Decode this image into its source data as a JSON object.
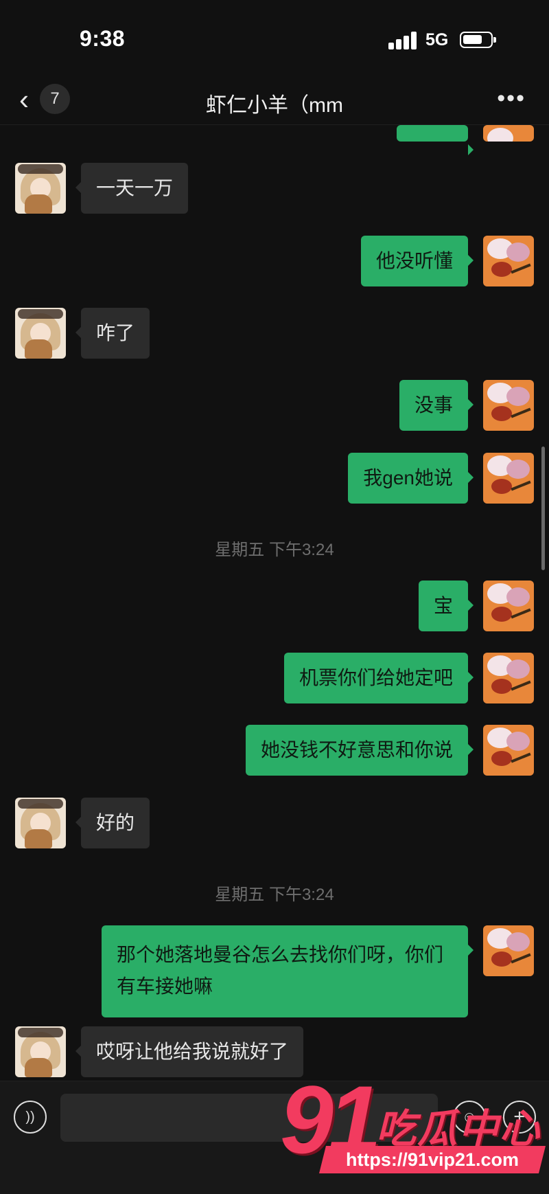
{
  "status_bar": {
    "time": "9:38",
    "network": "5G"
  },
  "nav": {
    "back_icon": "chevron-left-icon",
    "unread_count": "7",
    "title": "虾仁小羊（mm",
    "more_icon": "more-dots-icon"
  },
  "timestamps": [
    "星期五 下午3:24",
    "星期五 下午3:24"
  ],
  "messages": [
    {
      "sender": "contact",
      "text": "一天一万"
    },
    {
      "sender": "me",
      "text": "他没听懂"
    },
    {
      "sender": "contact",
      "text": "咋了"
    },
    {
      "sender": "me",
      "text": "没事"
    },
    {
      "sender": "me",
      "text": "我gen她说"
    },
    {
      "sender": "me",
      "text": "宝"
    },
    {
      "sender": "me",
      "text": "机票你们给她定吧"
    },
    {
      "sender": "me",
      "text": "她没钱不好意思和你说"
    },
    {
      "sender": "contact",
      "text": "好的"
    },
    {
      "sender": "me",
      "text": "那个她落地曼谷怎么去找你们呀，你们有车接她嘛"
    },
    {
      "sender": "contact",
      "text": "哎呀让他给我说就好了"
    }
  ],
  "input_bar": {
    "voice_icon": "voice-icon",
    "placeholder": "",
    "emoji_icon": "emoji-icon",
    "plus_icon": "plus-icon"
  },
  "watermark": {
    "number": "91",
    "brand": "吃瓜中心",
    "url": "https://91vip21.com"
  },
  "colors": {
    "background": "#111111",
    "bubble_out": "#2aae67",
    "bubble_in": "#2c2c2c",
    "watermark": "#f23b5f"
  }
}
